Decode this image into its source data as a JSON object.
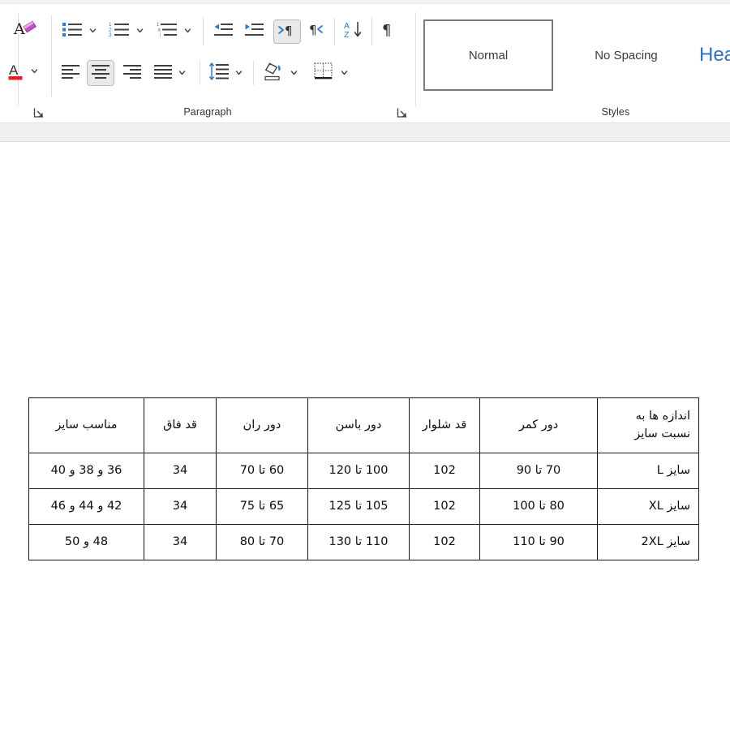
{
  "ribbon": {
    "groups": [
      {
        "name": "paragraph",
        "label": "Paragraph",
        "buttons": [
          {
            "id": "clear-formatting",
            "icon": "clear-formatting-icon",
            "tooltip": "Clear All Formatting"
          },
          {
            "id": "bullets",
            "icon": "bullet-list-icon",
            "tooltip": "Bullets"
          },
          {
            "id": "numbering",
            "icon": "numbered-list-icon",
            "tooltip": "Numbering"
          },
          {
            "id": "multilevel-list",
            "icon": "multilevel-list-icon",
            "tooltip": "Multilevel List"
          },
          {
            "id": "decrease-indent",
            "icon": "decrease-indent-icon",
            "tooltip": "Decrease Indent"
          },
          {
            "id": "increase-indent",
            "icon": "increase-indent-icon",
            "tooltip": "Increase Indent"
          },
          {
            "id": "rtl-text-direction",
            "icon": "right-to-left-text-icon",
            "tooltip": "Right-to-Left Text Direction",
            "active": true
          },
          {
            "id": "ltr-text-direction",
            "icon": "left-to-right-text-icon",
            "tooltip": "Left-to-Right Text Direction"
          },
          {
            "id": "sort",
            "icon": "sort-az-icon",
            "tooltip": "Sort"
          },
          {
            "id": "show-formatting-marks",
            "icon": "pilcrow-icon",
            "tooltip": "Show/Hide Formatting Marks"
          },
          {
            "id": "font-color",
            "icon": "font-color-icon",
            "tooltip": "Font Color"
          },
          {
            "id": "align-left",
            "icon": "align-left-icon",
            "tooltip": "Align Left"
          },
          {
            "id": "align-center",
            "icon": "align-center-icon",
            "tooltip": "Center",
            "active": true
          },
          {
            "id": "align-right",
            "icon": "align-right-icon",
            "tooltip": "Align Right"
          },
          {
            "id": "justify",
            "icon": "justify-icon",
            "tooltip": "Justify"
          },
          {
            "id": "line-spacing",
            "icon": "line-spacing-icon",
            "tooltip": "Line and Paragraph Spacing"
          },
          {
            "id": "shading",
            "icon": "shading-paint-bucket-icon",
            "tooltip": "Shading"
          },
          {
            "id": "borders",
            "icon": "borders-icon",
            "tooltip": "Borders"
          }
        ]
      },
      {
        "name": "styles",
        "label": "Styles",
        "gallery": [
          {
            "id": "normal",
            "label": "Normal",
            "selected": true
          },
          {
            "id": "no-spacing",
            "label": "No Spacing",
            "selected": false
          },
          {
            "id": "heading-1",
            "label": "Hea",
            "selected": false,
            "heading": true
          }
        ]
      }
    ],
    "colors": {
      "accent_blue": "#2b7cd3",
      "font_color_red": "#ee1c25",
      "active_button_bg": "#e9e9e9",
      "group_label": "#333333"
    }
  },
  "document": {
    "table": {
      "name": "size-chart-table",
      "direction": "rtl",
      "header": [
        "اندازه ها به نسبت سایز",
        "دور کمر",
        "قد شلوار",
        "دور باسن",
        "دور ران",
        "قد فاق",
        "مناسب سایز"
      ],
      "rows": [
        [
          "سایز   L",
          "70 تا 90",
          "102",
          "100 تا 120",
          "60 تا 70",
          "34",
          "36 و 38 و 40"
        ],
        [
          "سایز   XL",
          "80 تا 100",
          "102",
          "105 تا 125",
          "65 تا 75",
          "34",
          "42 و 44 و 46"
        ],
        [
          "سایز 2XL",
          "90 تا 110",
          "102",
          "110 تا 130",
          "70 تا 80",
          "34",
          "48 و 50"
        ]
      ]
    }
  }
}
